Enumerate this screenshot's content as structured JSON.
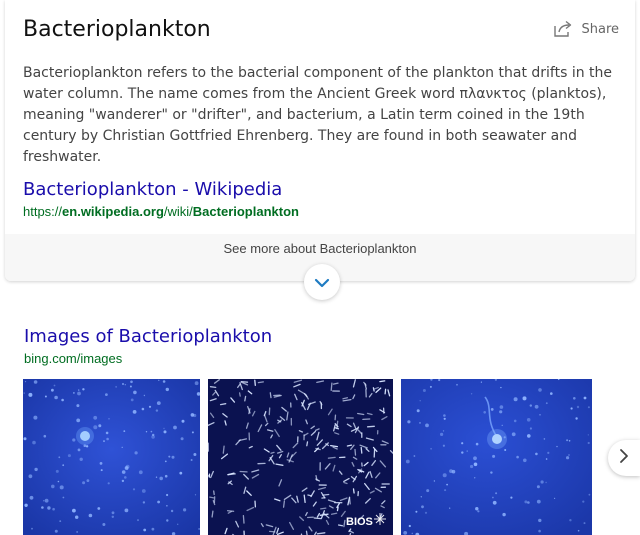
{
  "card": {
    "title": "Bacterioplankton",
    "share_label": "Share",
    "description": "Bacterioplankton refers to the bacterial component of the plankton that drifts in the water column. The name comes from the Ancient Greek word πλανκτος (planktos), meaning \"wanderer\" or \"drifter\", and bacterium, a Latin term coined in the 19th century by Christian Gottfried Ehrenberg. They are found in both seawater and freshwater.",
    "source_link": "Bacterioplankton - Wikipedia",
    "source_url_prefix": "https://",
    "source_url_domain": "en.wikipedia.org",
    "source_url_path": "/wiki/",
    "source_url_term": "Bacterioplankton",
    "see_more": "See more about Bacterioplankton"
  },
  "images": {
    "title": "Images of Bacterioplankton",
    "source": "bing.com/images",
    "watermark": "BIOS",
    "items": [
      {
        "icon": "bacteria-fluorescence-image-1"
      },
      {
        "icon": "bacteria-rods-image"
      },
      {
        "icon": "bacteria-fluorescence-image-2"
      }
    ]
  },
  "colors": {
    "link": "#1a0dab",
    "url_green": "#006d21",
    "thumb_blue": "#1f3fb8",
    "thumb_dark": "#0a0f4a"
  }
}
